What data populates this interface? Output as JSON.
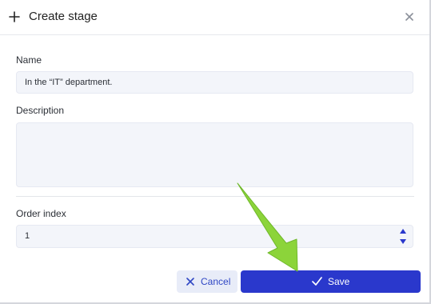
{
  "dialog": {
    "title": "Create stage",
    "header_icon": "plus-icon",
    "close_icon": "close-icon"
  },
  "form": {
    "name_label": "Name",
    "name_value": "In the “IT” department.",
    "description_label": "Description",
    "description_value": "",
    "order_label": "Order index",
    "order_value": "1"
  },
  "actions": {
    "cancel_label": "Cancel",
    "save_label": "Save"
  },
  "colors": {
    "primary": "#2a38cc",
    "cancel_bg": "#e8ecf8",
    "input_bg": "#f3f5fa",
    "annotation_arrow": "#8cd43a"
  }
}
